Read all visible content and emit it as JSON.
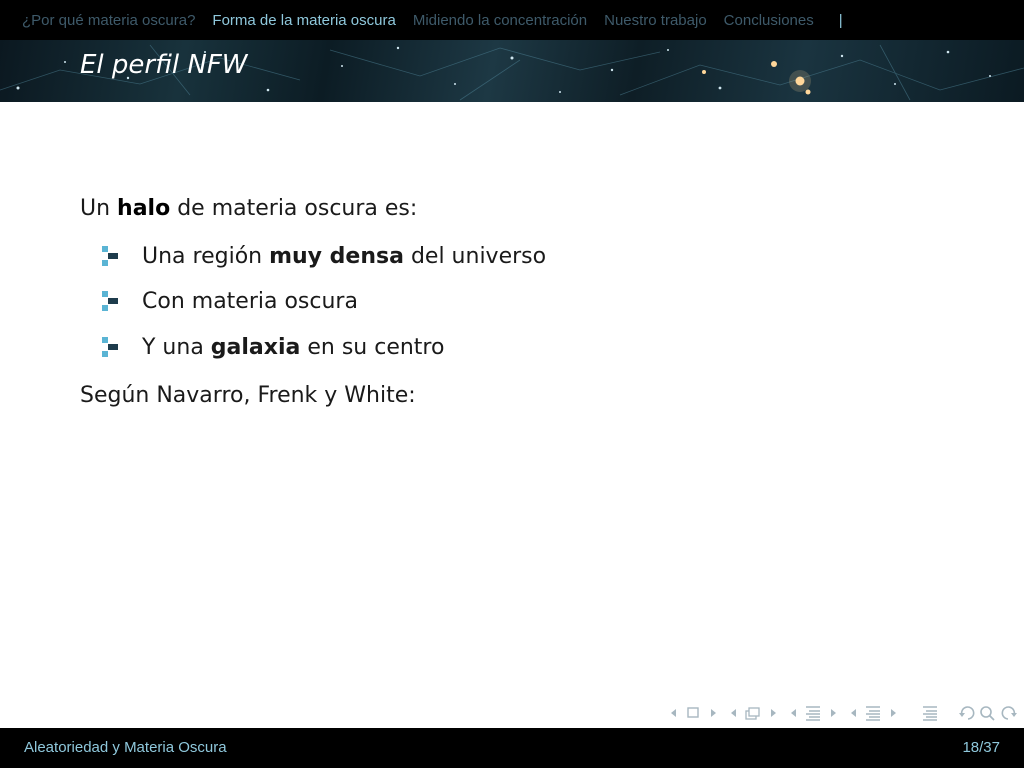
{
  "nav": {
    "sections": [
      {
        "label": "¿Por qué materia oscura?"
      },
      {
        "label": "Forma de la materia oscura"
      },
      {
        "label": "Midiendo la concentración"
      },
      {
        "label": "Nuestro trabajo"
      },
      {
        "label": "Conclusiones"
      }
    ],
    "active_index": 1,
    "separator": "|"
  },
  "slide": {
    "title": "El perfil NFW",
    "intro": {
      "pre": "Un ",
      "bold": "halo",
      "post": " de materia oscura es:"
    },
    "bullets": [
      {
        "pre": "Una región ",
        "bold": "muy densa",
        "post": " del universo"
      },
      {
        "pre": "Con materia oscura",
        "bold": "",
        "post": ""
      },
      {
        "pre": "Y una ",
        "bold": "galaxia",
        "post": " en su centro"
      }
    ],
    "closing": "Según Navarro, Frenk y White:"
  },
  "footer": {
    "title": "Aleatoriedad y Materia Oscura",
    "page": "18/37"
  },
  "colors": {
    "bar_background": "#000000",
    "active_text": "#8fc8dc",
    "inactive_text": "#3e5a6a",
    "bullet_light": "#5ab4d4",
    "bullet_dark": "#1e3c4c",
    "nav_symbols": "#a7b7c0"
  },
  "icons": {
    "bullet": "square-bullet-icon",
    "nav_symbols": [
      "slide-nav-icon",
      "frame-nav-icon",
      "subsection-nav-icon",
      "section-nav-icon",
      "outline-icon",
      "back-icon",
      "search-icon",
      "forward-icon"
    ]
  }
}
